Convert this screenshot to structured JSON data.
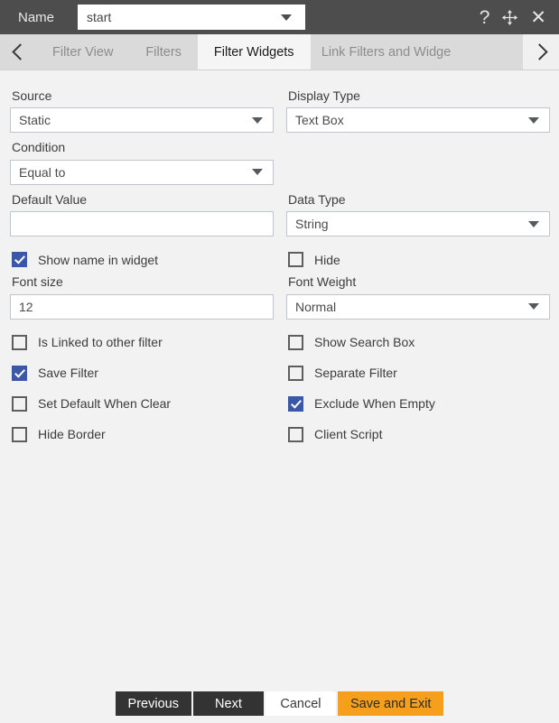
{
  "titlebar": {
    "name_label": "Name",
    "name_value": "start",
    "icons": {
      "help": "?",
      "move": "move-icon",
      "close": "✕"
    }
  },
  "tabs": {
    "prev_arrow": "chevron-left-icon",
    "next_arrow": "chevron-right-icon",
    "items": [
      {
        "label": "Filter View",
        "active": false
      },
      {
        "label": "Filters",
        "active": false
      },
      {
        "label": "Filter Widgets",
        "active": true
      },
      {
        "label": "Link Filters and Widge",
        "active": false
      }
    ]
  },
  "form": {
    "source": {
      "label": "Source",
      "value": "Static",
      "type": "select"
    },
    "display_type": {
      "label": "Display Type",
      "value": "Text Box",
      "type": "select"
    },
    "condition": {
      "label": "Condition",
      "value": "Equal to",
      "type": "select"
    },
    "default_value": {
      "label": "Default Value",
      "value": "",
      "type": "text"
    },
    "data_type": {
      "label": "Data Type",
      "value": "String",
      "type": "select"
    },
    "font_size": {
      "label": "Font size",
      "value": "12",
      "type": "text"
    },
    "font_weight": {
      "label": "Font Weight",
      "value": "Normal",
      "type": "select"
    }
  },
  "checkboxes": [
    {
      "label": "Show name in widget",
      "checked": true
    },
    {
      "label": "Hide",
      "checked": false
    },
    {
      "label": "Is Linked to other filter",
      "checked": false
    },
    {
      "label": "Show Search Box",
      "checked": false
    },
    {
      "label": "Save Filter",
      "checked": true
    },
    {
      "label": "Separate Filter",
      "checked": false
    },
    {
      "label": "Set Default When Clear",
      "checked": false
    },
    {
      "label": "Exclude When Empty",
      "checked": true
    },
    {
      "label": "Hide Border",
      "checked": false
    },
    {
      "label": "Client Script",
      "checked": false
    }
  ],
  "footer": {
    "previous": "Previous",
    "next": "Next",
    "cancel": "Cancel",
    "save_and_exit": "Save and Exit"
  },
  "colors": {
    "titlebar": "#4d4d4d",
    "background": "#f2f2f2",
    "tab_inactive": "#dadada",
    "tab_active": "#f5f5f5",
    "checkbox_checked": "#3b57a8",
    "accent_button": "#f59f1c",
    "dark_button": "#333333",
    "input_border": "#bcc7d3"
  }
}
